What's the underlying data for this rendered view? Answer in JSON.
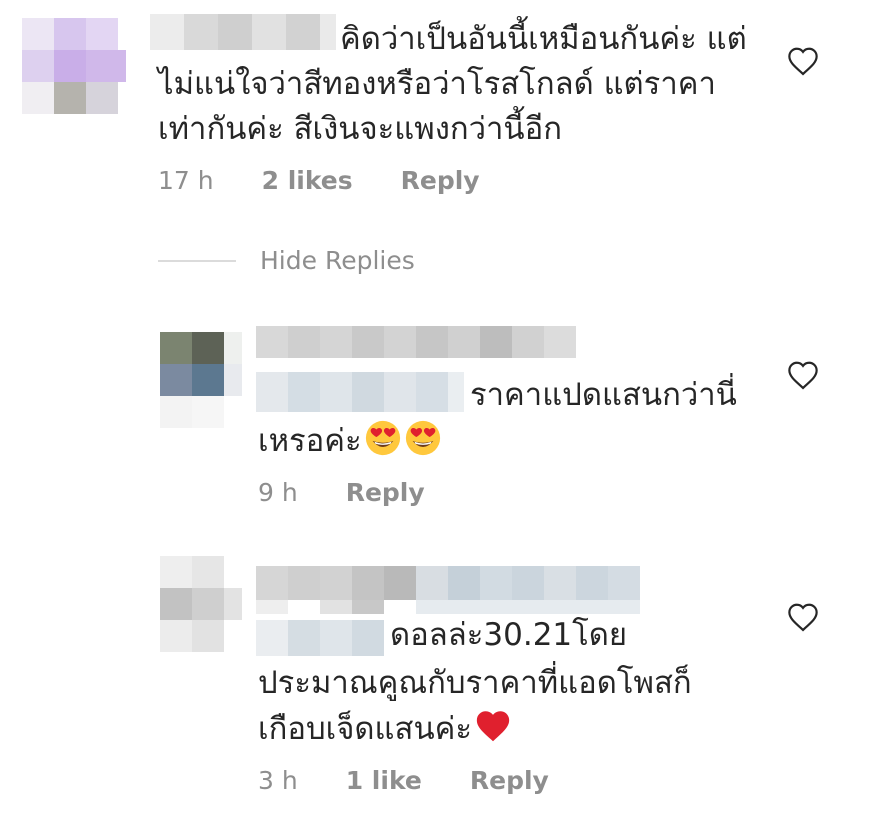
{
  "comments": [
    {
      "text_lines": [
        "คิดว่าเป็นอันนี้เหมือนกันค่ะ แต่",
        "ไม่แน่ใจว่าสีทองหรือว่าโรสโกลด์ แต่ราคา",
        "เท่ากันค่ะ สีเงินจะแพงกว่านี้อีก"
      ],
      "time": "17 h",
      "likes": "2 likes",
      "reply": "Reply"
    }
  ],
  "hide_replies": "Hide Replies",
  "replies": [
    {
      "text_lines": [
        "ราคาแปดแสนกว่านี่",
        "เหรอค่ะ"
      ],
      "emoji": [
        "heart-eyes-emoji",
        "heart-eyes-emoji"
      ],
      "time": "9 h",
      "reply": "Reply"
    },
    {
      "text_lines": [
        "ดอลล่ะ30.21โดย",
        "ประมาณคูณกับราคาที่แอดโพสก็",
        "เกือบเจ็ดแสนค่ะ"
      ],
      "emoji": [
        "red-heart-emoji"
      ],
      "time": "3 h",
      "likes": "1 like",
      "reply": "Reply"
    }
  ],
  "icons": {
    "like": "heart-outline-icon"
  },
  "colors": {
    "text": "#262626",
    "meta": "#8e8e8e",
    "divider": "#dbdbdb",
    "heart_outline": "#262626",
    "red_heart": "#e0202e"
  }
}
